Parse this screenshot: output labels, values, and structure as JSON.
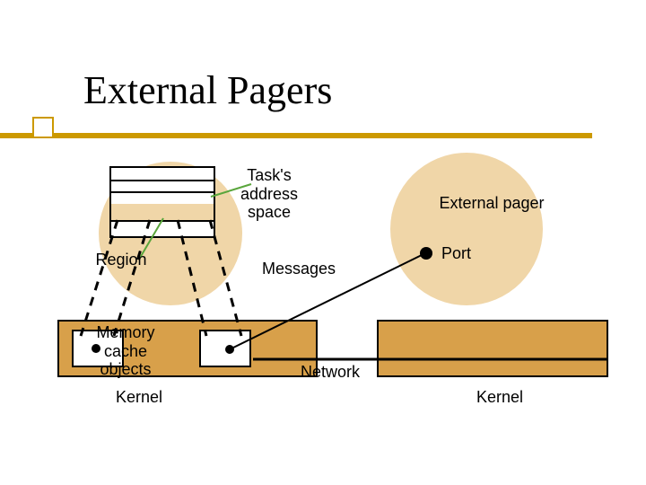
{
  "title": "External Pagers",
  "labels": {
    "task_address_space": "Task's\naddress\nspace",
    "external_pager": "External pager",
    "port": "Port",
    "region": "Region",
    "messages": "Messages",
    "memory_cache_objects": "Memory\ncache\nobjects",
    "network": "Network",
    "kernel_left": "Kernel",
    "kernel_right": "Kernel"
  },
  "colors": {
    "accent_bar": "#cc9900",
    "light_tan": "#f0d6a8",
    "dark_tan": "#d8a04a"
  },
  "diagram": {
    "nodes": [
      {
        "id": "task-address-space",
        "type": "table-box"
      },
      {
        "id": "region",
        "type": "highlighted-row"
      },
      {
        "id": "external-pager",
        "type": "circle"
      },
      {
        "id": "port",
        "type": "dot"
      },
      {
        "id": "memory-cache-object-1",
        "type": "box"
      },
      {
        "id": "memory-cache-object-2",
        "type": "box"
      },
      {
        "id": "kernel-left",
        "type": "bar"
      },
      {
        "id": "kernel-right",
        "type": "bar"
      }
    ],
    "edges": [
      {
        "from": "task-address-space",
        "to": "label-tas",
        "kind": "callout"
      },
      {
        "from": "region",
        "to": "label-region",
        "kind": "callout"
      },
      {
        "from": "region",
        "to": "memory-cache-object-1",
        "kind": "map-dashed"
      },
      {
        "from": "region",
        "to": "memory-cache-object-2",
        "kind": "map-dashed"
      },
      {
        "from": "memory-cache-object-2",
        "to": "port",
        "kind": "messages"
      },
      {
        "from": "kernel-left",
        "to": "kernel-right",
        "kind": "network-link"
      }
    ]
  }
}
